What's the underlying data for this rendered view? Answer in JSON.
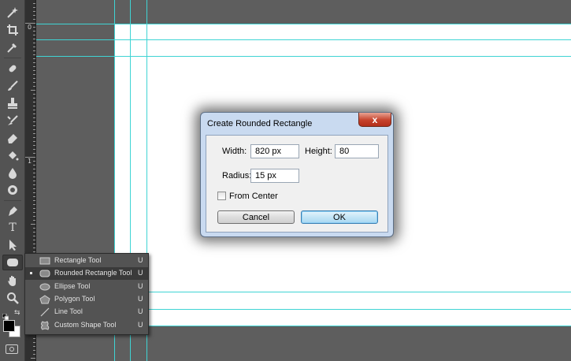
{
  "dialog": {
    "title": "Create Rounded Rectangle",
    "width_label": "Width:",
    "width_value": "820 px",
    "height_label": "Height:",
    "height_value": "80",
    "radius_label": "Radius:",
    "radius_value": "15 px",
    "from_center_label": "From Center",
    "from_center_checked": false,
    "cancel_label": "Cancel",
    "ok_label": "OK",
    "close_glyph": "x"
  },
  "ruler": {
    "labels": [
      "0",
      "1"
    ]
  },
  "flyout": {
    "items": [
      {
        "label": "Rectangle Tool",
        "shortcut": "U",
        "icon": "rectangle-icon",
        "selected": false
      },
      {
        "label": "Rounded Rectangle Tool",
        "shortcut": "U",
        "icon": "rounded-rectangle-icon",
        "selected": true
      },
      {
        "label": "Ellipse Tool",
        "shortcut": "U",
        "icon": "ellipse-icon",
        "selected": false
      },
      {
        "label": "Polygon Tool",
        "shortcut": "U",
        "icon": "polygon-icon",
        "selected": false
      },
      {
        "label": "Line Tool",
        "shortcut": "U",
        "icon": "line-icon",
        "selected": false
      },
      {
        "label": "Custom Shape Tool",
        "shortcut": "U",
        "icon": "custom-shape-icon",
        "selected": false
      }
    ]
  },
  "toolbar": {
    "tools": [
      "magic-wand-icon",
      "crop-icon",
      "eyedropper-icon",
      "healing-brush-icon",
      "brush-icon",
      "clone-stamp-icon",
      "history-brush-icon",
      "eraser-icon",
      "paint-bucket-icon",
      "blur-icon",
      "dodge-icon",
      "pen-icon",
      "type-icon",
      "path-selection-icon",
      "rounded-rectangle-shape-icon",
      "hand-icon",
      "zoom-icon"
    ],
    "type_glyph": "T"
  },
  "colors": {
    "guide": "#3fd4d4",
    "foreground": "#000000",
    "background": "#ffffff",
    "close_button": "#c6422c"
  }
}
